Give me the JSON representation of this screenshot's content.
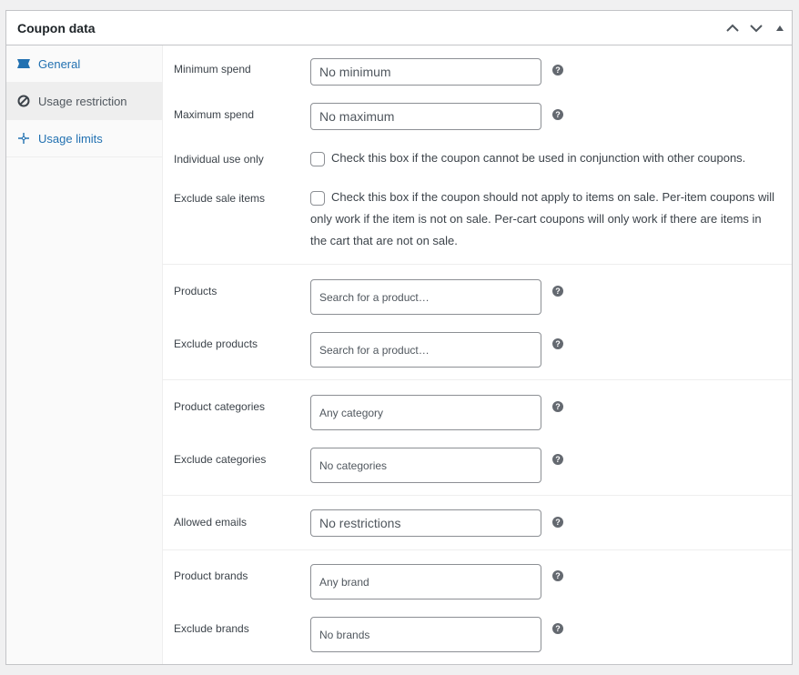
{
  "header": {
    "title": "Coupon data"
  },
  "icons": {
    "collapse_up": "chevron-up-icon",
    "collapse_down": "chevron-down-icon",
    "toggle": "triangle-up-icon"
  },
  "tabs": [
    {
      "label": "General",
      "icon": "ticket-icon",
      "active": false
    },
    {
      "label": "Usage restriction",
      "icon": "block-icon",
      "active": true
    },
    {
      "label": "Usage limits",
      "icon": "crosshair-icon",
      "active": false
    }
  ],
  "fields": {
    "minimum_spend": {
      "label": "Minimum spend",
      "placeholder": "No minimum"
    },
    "maximum_spend": {
      "label": "Maximum spend",
      "placeholder": "No maximum"
    },
    "individual_use": {
      "label": "Individual use only",
      "description": "Check this box if the coupon cannot be used in conjunction with other coupons."
    },
    "exclude_sale": {
      "label": "Exclude sale items",
      "description": "Check this box if the coupon should not apply to items on sale. Per-item coupons will only work if the item is not on sale. Per-cart coupons will only work if there are items in the cart that are not on sale."
    },
    "products": {
      "label": "Products",
      "placeholder": "Search for a product…"
    },
    "exclude_products": {
      "label": "Exclude products",
      "placeholder": "Search for a product…"
    },
    "product_categories": {
      "label": "Product categories",
      "placeholder": "Any category"
    },
    "exclude_categories": {
      "label": "Exclude categories",
      "placeholder": "No categories"
    },
    "allowed_emails": {
      "label": "Allowed emails",
      "placeholder": "No restrictions"
    },
    "product_brands": {
      "label": "Product brands",
      "placeholder": "Any brand"
    },
    "exclude_brands": {
      "label": "Exclude brands",
      "placeholder": "No brands"
    }
  },
  "help_glyph": "?",
  "colors": {
    "link": "#2271b1",
    "border": "#c3c4c7",
    "input_border": "#8c8f94",
    "help": "#646970"
  }
}
